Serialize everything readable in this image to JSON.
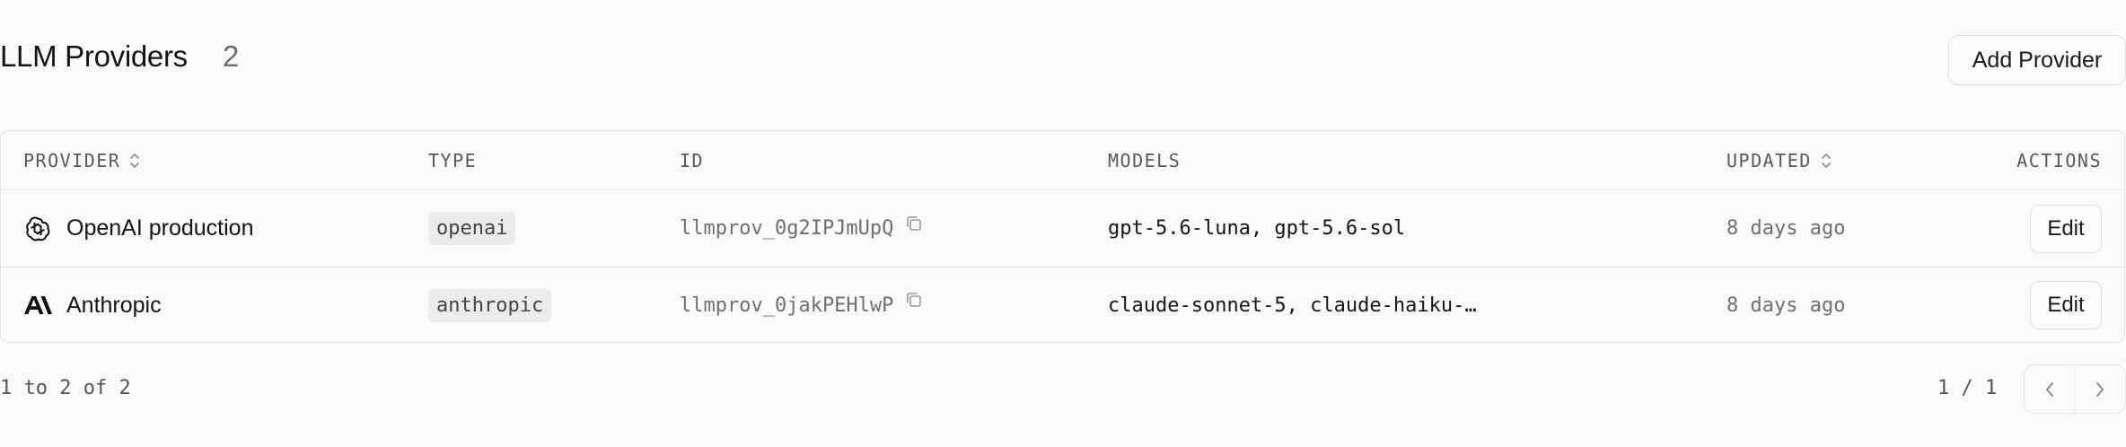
{
  "header": {
    "title": "LLM Providers",
    "count": "2",
    "add_button_label": "Add Provider"
  },
  "table": {
    "columns": {
      "provider": "PROVIDER",
      "type": "TYPE",
      "id": "ID",
      "models": "MODELS",
      "updated": "UPDATED",
      "actions": "ACTIONS"
    },
    "rows": [
      {
        "icon": "openai-logo-icon",
        "provider": "OpenAI production",
        "type": "openai",
        "id": "llmprov_0g2IPJmUpQ",
        "models": "gpt-5.6-luna, gpt-5.6-sol",
        "updated": "8 days ago",
        "action_label": "Edit"
      },
      {
        "icon": "anthropic-logo-icon",
        "provider": "Anthropic",
        "type": "anthropic",
        "id": "llmprov_0jakPEHlwP",
        "models": "claude-sonnet-5, claude-haiku-…",
        "updated": "8 days ago",
        "action_label": "Edit"
      }
    ]
  },
  "footer": {
    "range_text": "1 to 2 of 2",
    "page_text": "1 / 1"
  },
  "colors": {
    "background": "#fafafa",
    "border": "#e3e3e3",
    "text": "#171717",
    "muted": "#707070",
    "pill": "#ececec"
  }
}
